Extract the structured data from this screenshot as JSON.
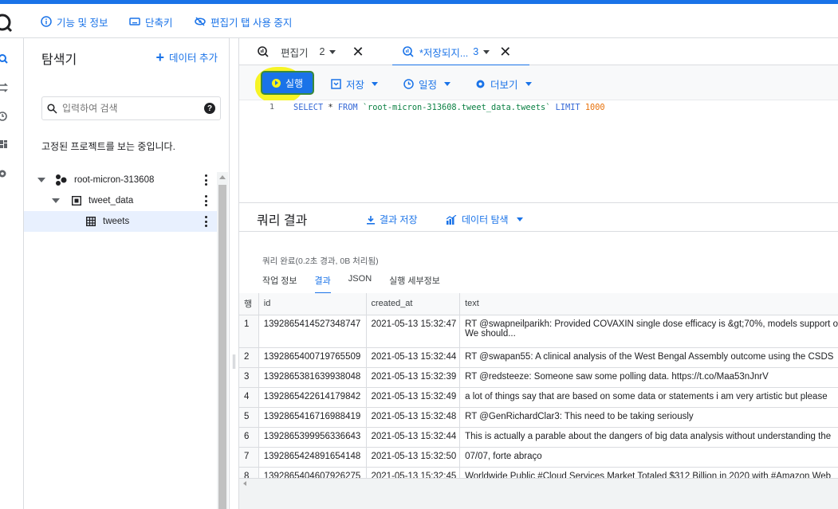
{
  "colors": {
    "accent": "#1a73e8",
    "highlight": "#f5f31a",
    "border": "#dadce0"
  },
  "header": {
    "features_label": "기능 및 정보",
    "shortcuts_label": "단축키",
    "disable_tabs_label": "편집기 탭 사용 중지"
  },
  "explorer": {
    "title": "탐색기",
    "add_data_label": "데이터 추가",
    "search_placeholder": "입력하여 검색",
    "pinned_text": "고정된 프로젝트를 보는 중입니다.",
    "tree": [
      {
        "label": "root-micron-313608",
        "icon": "project-icon"
      },
      {
        "label": "tweet_data",
        "icon": "dataset-icon"
      },
      {
        "label": "tweets",
        "icon": "table-icon"
      }
    ]
  },
  "tabs": [
    {
      "label": "편집기",
      "number": "2"
    },
    {
      "label": "*저장되지...",
      "number": "3"
    }
  ],
  "toolbar": {
    "run_label": "실행",
    "save_label": "저장",
    "schedule_label": "일정",
    "more_label": "더보기"
  },
  "editor": {
    "line_number": "1",
    "tokens": {
      "select": "SELECT",
      "star": " * ",
      "from": "FROM",
      "table": "`root-micron-313608.tweet_data.tweets`",
      "limit": "LIMIT",
      "limit_value": "1000"
    }
  },
  "results": {
    "title": "쿼리 결과",
    "save_results_label": "결과 저장",
    "explore_data_label": "데이터 탐색",
    "status": "쿼리 완료(0.2초 경과, 0B 처리됨)",
    "subtabs": [
      "작업 정보",
      "결과",
      "JSON",
      "실행 세부정보"
    ],
    "columns": [
      "행",
      "id",
      "created_at",
      "text"
    ],
    "rows": [
      [
        "1",
        "1392865414527348747",
        "2021-05-13 15:32:47",
        "RT @swapneilparikh: Provided COVAXIN single dose efficacy is &gt;70%, models support o",
        "We should..."
      ],
      [
        "2",
        "1392865400719765509",
        "2021-05-13 15:32:44",
        "RT @swapan55: A clinical analysis of the West Bengal Assembly outcome using the CSDS",
        ""
      ],
      [
        "3",
        "1392865381639938048",
        "2021-05-13 15:32:39",
        "RT @redsteeze: Someone saw some polling data. https://t.co/Maa53nJnrV",
        ""
      ],
      [
        "4",
        "1392865422614179842",
        "2021-05-13 15:32:49",
        "a lot of things say that are based on some data or statements i am very artistic but please",
        ""
      ],
      [
        "5",
        "1392865416716988419",
        "2021-05-13 15:32:48",
        "RT @GenRichardClar3: This need to be taking seriously",
        ""
      ],
      [
        "6",
        "1392865399956336643",
        "2021-05-13 15:32:44",
        "This is actually a parable about the dangers of big data analysis without understanding the",
        ""
      ],
      [
        "7",
        "1392865424891654148",
        "2021-05-13 15:32:50",
        "07/07, forte abraço",
        ""
      ],
      [
        "8",
        "1392865404607926275",
        "2021-05-13 15:32:45",
        "Worldwide Public #Cloud Services Market Totaled $312 Billion in 2020 with #Amazon Web",
        ""
      ]
    ]
  }
}
